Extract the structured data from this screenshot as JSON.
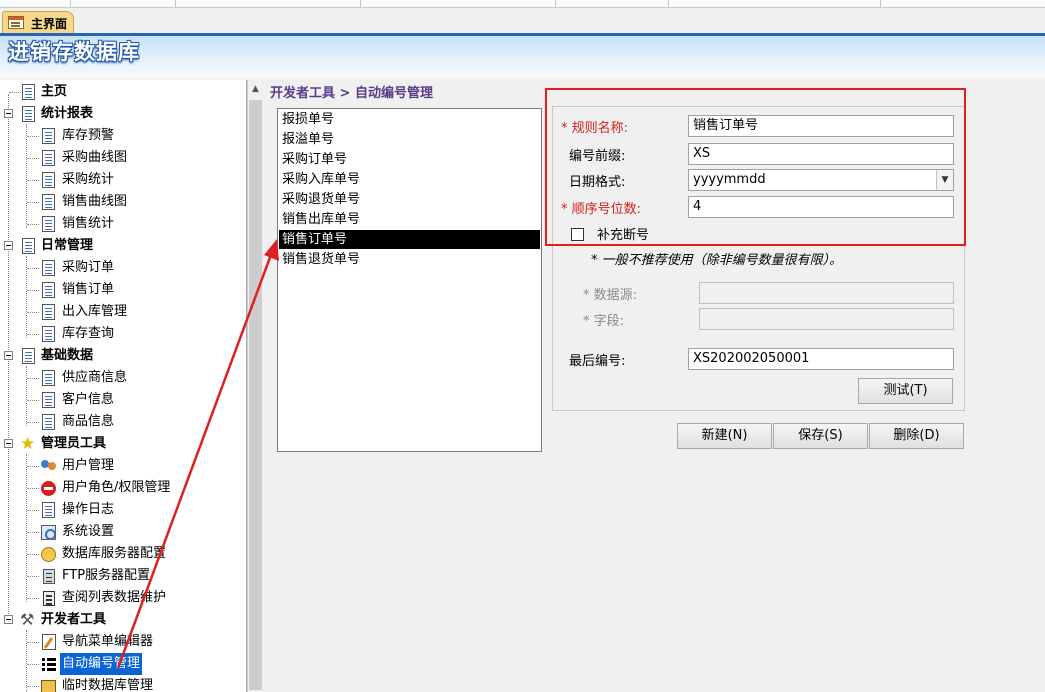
{
  "tab": {
    "label": "主界面"
  },
  "banner": {
    "title": "进销存数据库"
  },
  "nav": {
    "items": [
      {
        "label": "主页"
      },
      {
        "label": "统计报表"
      },
      {
        "label": "库存预警"
      },
      {
        "label": "采购曲线图"
      },
      {
        "label": "采购统计"
      },
      {
        "label": "销售曲线图"
      },
      {
        "label": "销售统计"
      },
      {
        "label": "日常管理"
      },
      {
        "label": "采购订单"
      },
      {
        "label": "销售订单"
      },
      {
        "label": "出入库管理"
      },
      {
        "label": "库存查询"
      },
      {
        "label": "基础数据"
      },
      {
        "label": "供应商信息"
      },
      {
        "label": "客户信息"
      },
      {
        "label": "商品信息"
      },
      {
        "label": "管理员工具"
      },
      {
        "label": "用户管理"
      },
      {
        "label": "用户角色/权限管理"
      },
      {
        "label": "操作日志"
      },
      {
        "label": "系统设置"
      },
      {
        "label": "数据库服务器配置"
      },
      {
        "label": "FTP服务器配置"
      },
      {
        "label": "查阅列表数据维护"
      },
      {
        "label": "开发者工具"
      },
      {
        "label": "导航菜单编辑器"
      },
      {
        "label": "自动编号管理"
      },
      {
        "label": "临时数据库管理"
      }
    ]
  },
  "breadcrumb": "开发者工具 > 自动编号管理",
  "rules": [
    "报损单号",
    "报溢单号",
    "采购订单号",
    "采购入库单号",
    "采购退货单号",
    "销售出库单号",
    "销售订单号",
    "销售退货单号"
  ],
  "form": {
    "rule_name_label": "* 规则名称:",
    "rule_name_value": "销售订单号",
    "prefix_label": "编号前缀:",
    "prefix_value": "XS",
    "date_format_label": "日期格式:",
    "date_format_value": "yyyymmdd",
    "seq_digits_label": "* 顺序号位数:",
    "seq_digits_value": "4",
    "fill_gaps_label": "补充断号",
    "fill_gaps_checked": false,
    "note": "* 一般不推荐使用（除非编号数量很有限）。",
    "datasource_label": "* 数据源:",
    "datasource_value": "",
    "field_label": "* 字段:",
    "field_value": "",
    "last_number_label": "最后编号:",
    "last_number_value": "XS202002050001",
    "test_button": "测试(T)"
  },
  "buttons": {
    "new": "新建(N)",
    "save": "保存(S)",
    "delete": "删除(D)"
  },
  "colors": {
    "highlight": "#e02020",
    "required": "#d82020",
    "selection": "#0a64d6",
    "breadcrumb": "#5b3a8a"
  }
}
